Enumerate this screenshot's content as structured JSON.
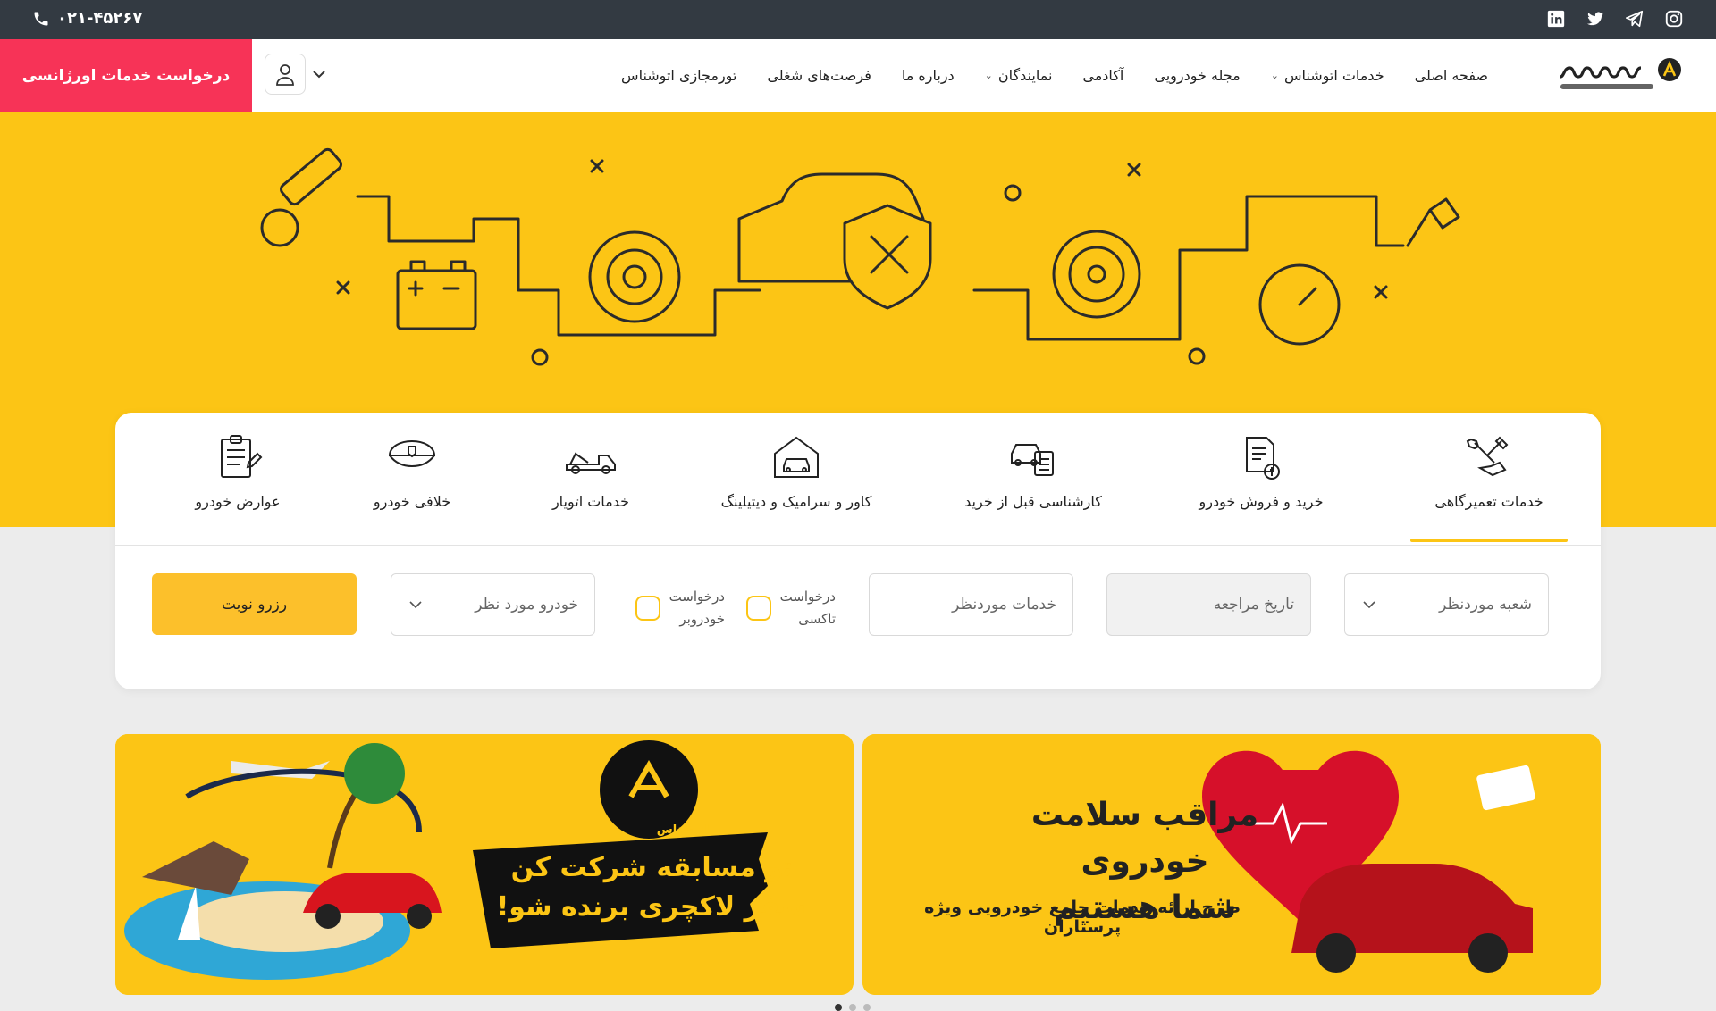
{
  "topbar": {
    "phone": "۰۲۱-۴۵۲۶۷",
    "social": [
      "instagram-icon",
      "telegram-icon",
      "twitter-icon",
      "linkedin-icon"
    ]
  },
  "header": {
    "logo_alt": "اتوشناس",
    "nav": [
      {
        "label": "صفحه اصلی",
        "dropdown": false
      },
      {
        "label": "خدمات اتوشناس",
        "dropdown": true
      },
      {
        "label": "مجله خودرویی",
        "dropdown": false
      },
      {
        "label": "آکادمی",
        "dropdown": false
      },
      {
        "label": "نمایندگان",
        "dropdown": true
      },
      {
        "label": "درباره ما",
        "dropdown": false
      },
      {
        "label": "فرصت‌های شغلی",
        "dropdown": false
      },
      {
        "label": "تورمجازی اتوشناس",
        "dropdown": false
      }
    ],
    "emergency_label": "درخواست خدمات اورژانسی"
  },
  "services": {
    "tabs": [
      {
        "label": "خدمات تعمیرگاهی",
        "icon": "wrench-hand-icon",
        "active": true
      },
      {
        "label": "خرید و فروش خودرو",
        "icon": "document-money-icon",
        "active": false
      },
      {
        "label": "کارشناسی قبل از خرید",
        "icon": "car-checklist-icon",
        "active": false
      },
      {
        "label": "کاور و سرامیک و دیتیلینگ",
        "icon": "garage-car-icon",
        "active": false
      },
      {
        "label": "خدمات اتویار",
        "icon": "tow-truck-icon",
        "active": false
      },
      {
        "label": "خلافی خودرو",
        "icon": "police-cap-icon",
        "active": false
      },
      {
        "label": "عوارض خودرو",
        "icon": "clipboard-icon",
        "active": false
      }
    ],
    "form": {
      "branch_placeholder": "شعبه موردنظر",
      "date_placeholder": "تاریخ مراجعه",
      "service_placeholder": "خدمات موردنظر",
      "taxi_label": [
        "درخواست",
        "تاکسی"
      ],
      "tow_label": [
        "درخواست",
        "خودروبر"
      ],
      "car_placeholder": "خودرو مورد نظر",
      "reserve_label": "رزرو نوبت"
    }
  },
  "banners": {
    "right": {
      "title_line1": "مراقب سلامت خودروی",
      "title_line2": "شما هستیم",
      "subtitle": "طرح ارائه خدمات جامع خودرویی ویژه پرستاران"
    },
    "left": {
      "logo_text": "اتوشناس",
      "line1": "تو مسابقه شرکت کن",
      "line2": "سفر لاکچری برنده شو!"
    }
  },
  "colors": {
    "brand_yellow": "#fcc515",
    "emergency_red": "#f73357",
    "topbar": "#333a42"
  }
}
